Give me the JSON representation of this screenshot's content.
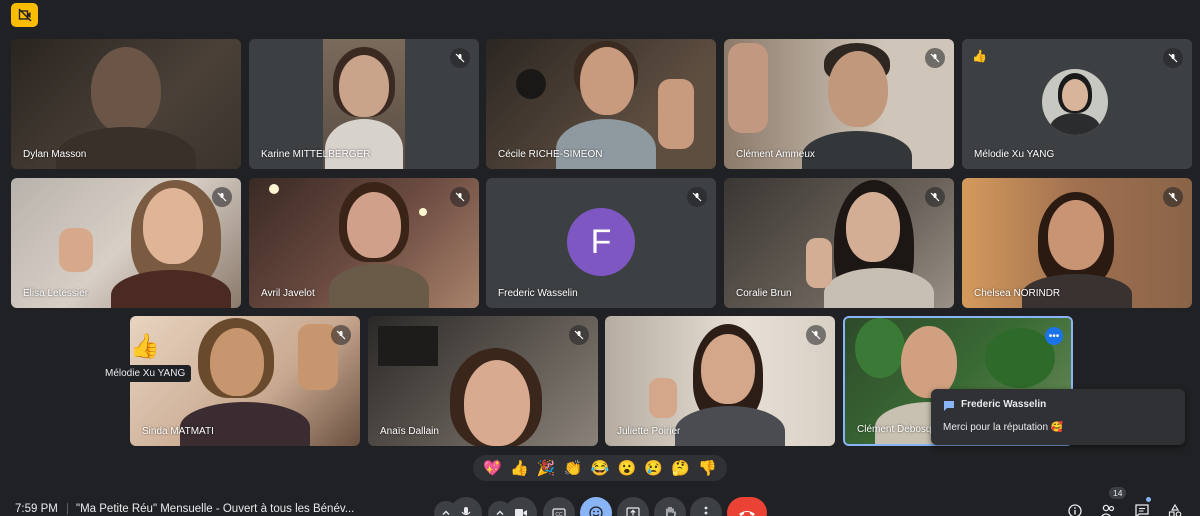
{
  "participants": [
    {
      "name": "Dylan Masson"
    },
    {
      "name": "Karine MITTELBERGER"
    },
    {
      "name": "Cécile RICHE-SIMEON"
    },
    {
      "name": "Clément Ammeux"
    },
    {
      "name": "Mélodie Xu YANG",
      "reaction": "👍"
    },
    {
      "name": "Elisa Letessier"
    },
    {
      "name": "Avril Javelot"
    },
    {
      "name": "Frederic Wasselin",
      "initial": "F"
    },
    {
      "name": "Coralie Brun"
    },
    {
      "name": "Chelsea NORINDR"
    },
    {
      "name": "Sinda MATMATI"
    },
    {
      "name": "Anaïs Dallain"
    },
    {
      "name": "Juliette Poirier"
    },
    {
      "name": "Clément Debosq"
    }
  ],
  "tooltip": "Mélodie Xu YANG",
  "floating_reaction": "👍",
  "chat_popup": {
    "sender": "Frederic Wasselin",
    "message": "Merci pour la réputation 🥰"
  },
  "reactions_bar": [
    "💖",
    "👍",
    "🎉",
    "👏",
    "😂",
    "😮",
    "😢",
    "🤔",
    "👎"
  ],
  "footer": {
    "time": "7:59 PM",
    "separator": "|",
    "meeting_title": "\"Ma Petite Réu\" Mensuelle - Ouvert à tous les Bénév..."
  },
  "people_count": "14",
  "colors": {
    "background": "#202124",
    "tile": "#3c4043",
    "end_call": "#ea4335",
    "active": "#8ab4f8",
    "badge": "#fbbc04",
    "avatar_purple": "#7e57c2"
  }
}
